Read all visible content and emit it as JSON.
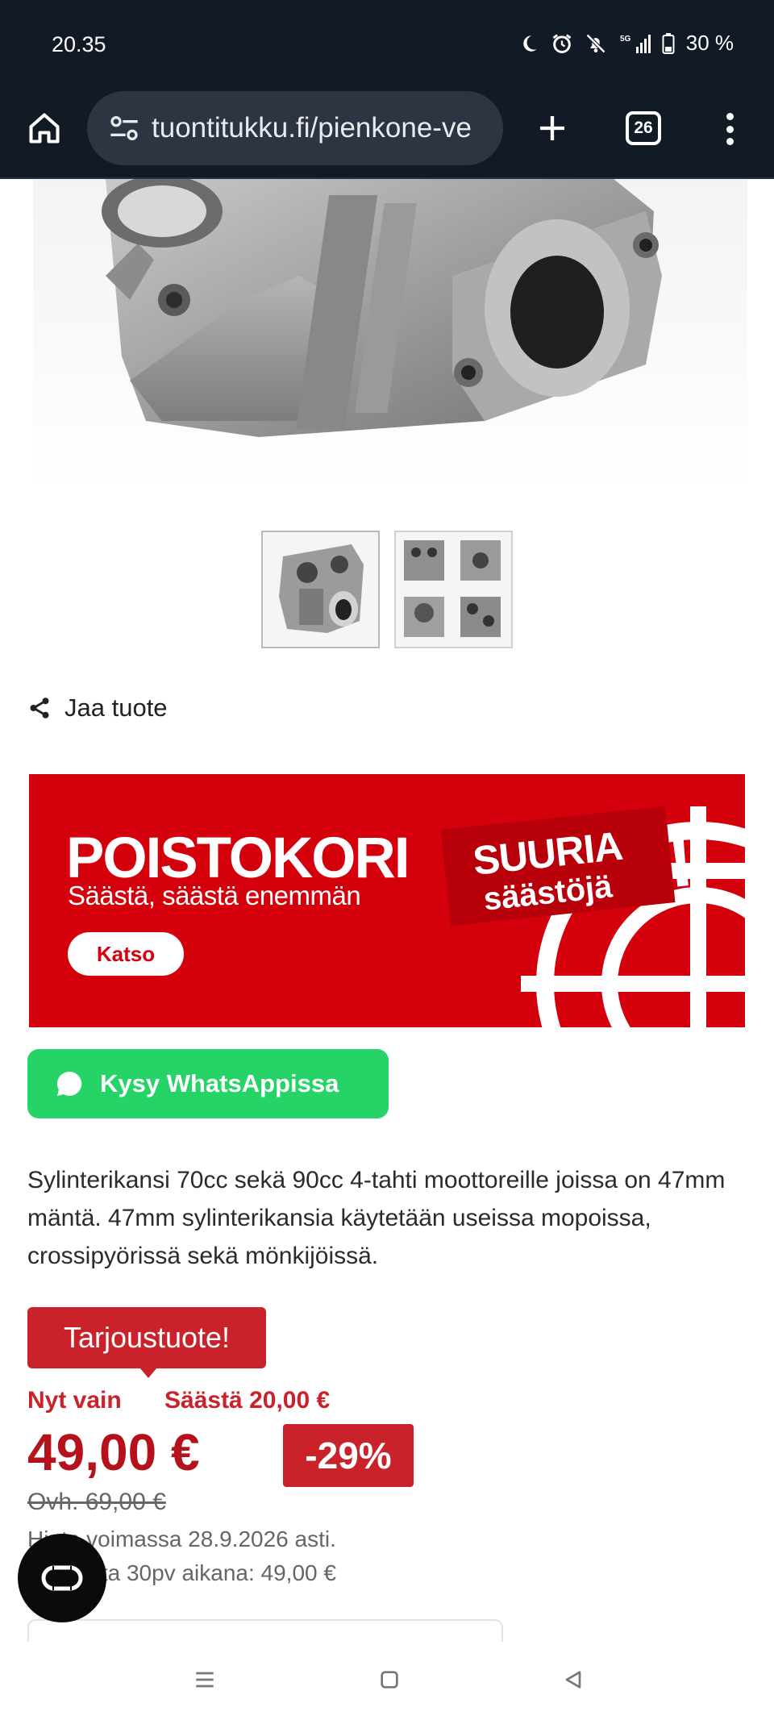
{
  "status": {
    "time": "20.35",
    "battery": "30 %"
  },
  "browser": {
    "url": "tuontitukku.fi/pienkone-ve",
    "tab_count": "26"
  },
  "share": {
    "label": "Jaa tuote"
  },
  "banner": {
    "title": "POISTOKORI",
    "subtitle": "Säästä, säästä enemmän",
    "button": "Katso",
    "badge_line1": "SUURIA",
    "badge_line2": "säästöjä",
    "badge_mark": "!",
    "color": "#d4000c"
  },
  "whatsapp": {
    "label": "Kysy WhatsAppissa",
    "color": "#25d366"
  },
  "description": "Sylinterikansi 70cc sekä 90cc 4-tahti moottoreille joissa on 47mm mäntä. 47mm sylinterikansia käytetään useissa mopoissa, crossipyörissä sekä mönkijöissä.",
  "offer": {
    "badge": "Tarjoustuote!",
    "now_only": "Nyt vain",
    "save": "Säästä 20,00 €",
    "price": "49,00 €",
    "discount": "-29%",
    "old_price": "Ovh. 69,00 €",
    "valid": "Hinta voimassa 28.9.2026 asti.",
    "lowest": "Alin hinta 30pv aikana: 49,00 €",
    "accent": "#c9222a"
  }
}
